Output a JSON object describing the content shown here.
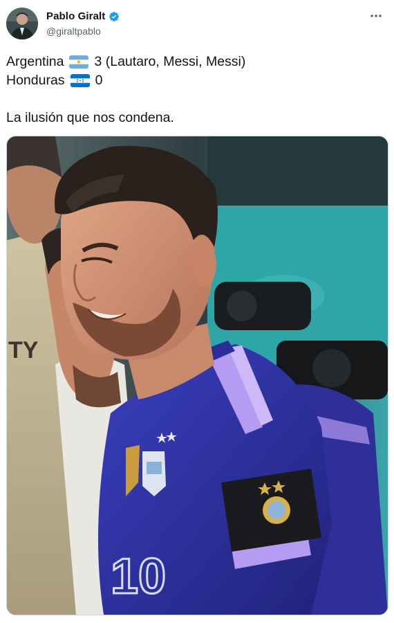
{
  "author": {
    "display_name": "Pablo Giralt",
    "handle": "@giraltpablo",
    "verified": true,
    "avatar_icon": "profile-photo"
  },
  "menu": {
    "icon": "more-horizontal-icon"
  },
  "tweet": {
    "lines": [
      {
        "team": "Argentina",
        "flag": "argentina-flag",
        "score": "3 (Lautaro, Messi, Messi)"
      },
      {
        "team": "Honduras",
        "flag": "honduras-flag",
        "score": "0"
      }
    ],
    "caption": "La ilusión que nos condena."
  },
  "media": {
    "description_icon": "photo",
    "shirt_text": "TY",
    "jersey_number": "10"
  },
  "colors": {
    "verified_blue": "#1d9bf0",
    "secondary_text": "#536471",
    "primary_text": "#0f1419"
  }
}
